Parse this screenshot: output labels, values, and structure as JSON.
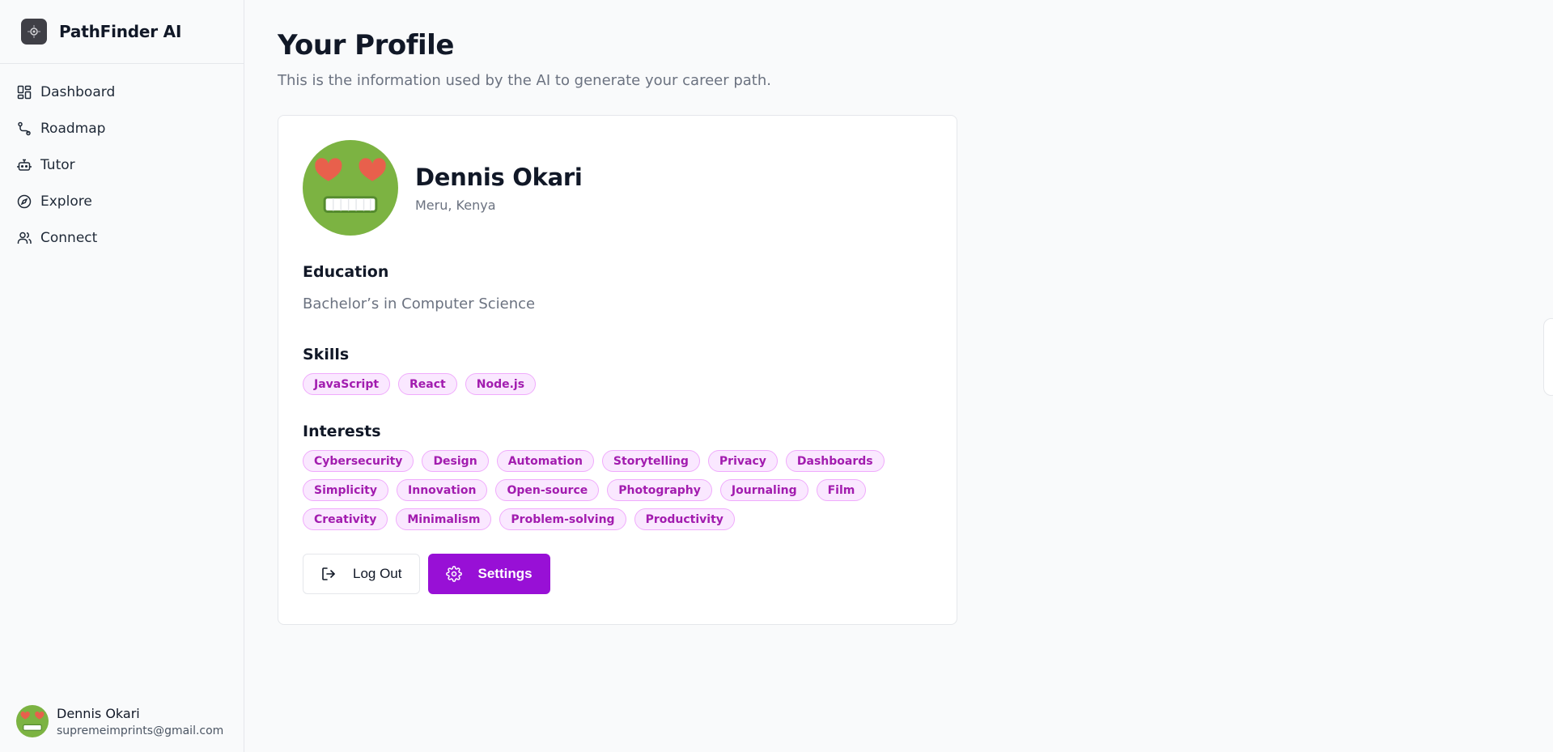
{
  "brand": {
    "name": "PathFinder AI"
  },
  "nav": {
    "items": [
      {
        "label": "Dashboard",
        "icon": "dashboard-icon"
      },
      {
        "label": "Roadmap",
        "icon": "route-icon"
      },
      {
        "label": "Tutor",
        "icon": "bot-icon"
      },
      {
        "label": "Explore",
        "icon": "compass-icon"
      },
      {
        "label": "Connect",
        "icon": "users-icon"
      }
    ]
  },
  "sidebar_user": {
    "name": "Dennis Okari",
    "email": "supremeimprints@gmail.com"
  },
  "page": {
    "title": "Your Profile",
    "subtitle": "This is the information used by the AI to generate your career path."
  },
  "profile": {
    "name": "Dennis Okari",
    "location": "Meru, Kenya",
    "education_title": "Education",
    "education": "Bachelor’s in Computer Science",
    "skills_title": "Skills",
    "skills": [
      "JavaScript",
      "React",
      "Node.js"
    ],
    "interests_title": "Interests",
    "interests": [
      "Cybersecurity",
      "Design",
      "Automation",
      "Storytelling",
      "Privacy",
      "Dashboards",
      "Simplicity",
      "Innovation",
      "Open-source",
      "Photography",
      "Journaling",
      "Film",
      "Creativity",
      "Minimalism",
      "Problem-solving",
      "Productivity"
    ]
  },
  "actions": {
    "logout_label": "Log Out",
    "settings_label": "Settings"
  },
  "colors": {
    "accent": "#9810d6",
    "tag_text": "#a21caf",
    "tag_bg": "#fae8ff",
    "avatar_green": "#7cb342",
    "heart": "#e8604c"
  }
}
